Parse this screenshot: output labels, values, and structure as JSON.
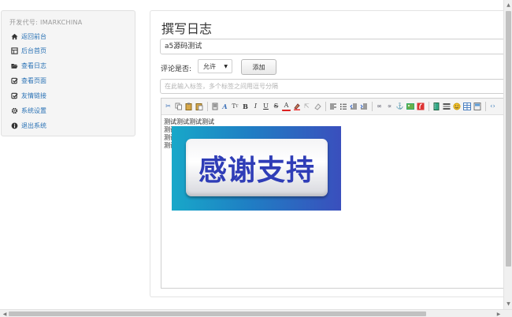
{
  "sidebar": {
    "developer_label": "开发代号: IMARKCHINA",
    "items": [
      {
        "label": "返回前台",
        "icon": "home-icon"
      },
      {
        "label": "后台首页",
        "icon": "dashboard-icon"
      },
      {
        "label": "查看日志",
        "icon": "folder-open-icon"
      },
      {
        "label": "查看页面",
        "icon": "check-square-icon"
      },
      {
        "label": "友情链接",
        "icon": "check-square-icon"
      },
      {
        "label": "系统设置",
        "icon": "gear-icon"
      },
      {
        "label": "退出系统",
        "icon": "info-circle-icon"
      }
    ],
    "link_color": "#2a72b5"
  },
  "main": {
    "page_title": "撰写日志",
    "title_value": "a5源码测试",
    "comment_label": "评论是否:",
    "comment_select": {
      "selected": "允许"
    },
    "add_button": "添加",
    "tags_placeholder": "在此输入标签，多个标签之间用逗号分隔",
    "editor_lines": [
      "测试测试测试测试",
      "测试",
      "测试",
      "测试"
    ]
  },
  "banner": {
    "text": "感谢支持",
    "text_color": "#2f3db7"
  }
}
